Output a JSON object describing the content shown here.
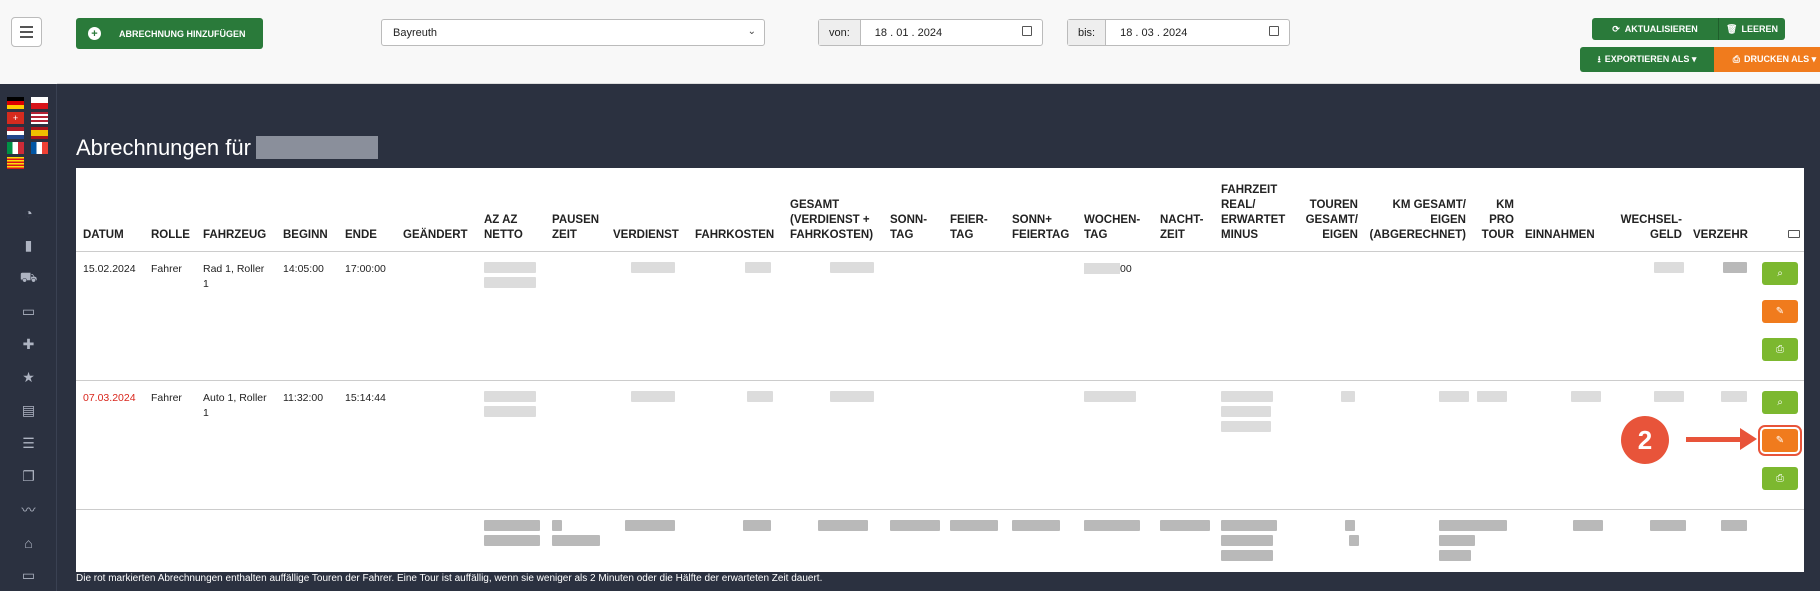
{
  "header": {
    "add_label": "ABRECHNUNG HINZUFÜGEN",
    "location": "Bayreuth",
    "from_label": "von:",
    "from_date": "18 . 01 . 2024",
    "to_label": "bis:",
    "to_date": "18 . 03 . 2024",
    "refresh_label": "AKTUALISIEREN",
    "clear_label": "LEEREN",
    "export_label": "EXPORTIEREN ALS ▾",
    "print_label": "DRUCKEN ALS ▾"
  },
  "page": {
    "title": "Abrechnungen für",
    "footnote": "Die rot markierten Abrechnungen enthalten auffällige Touren der Fahrer. Eine Tour ist auffällig, wenn sie weniger als 2 Minuten oder die Hälfte der erwarteten Zeit dauert."
  },
  "table": {
    "columns": [
      "DATUM",
      "ROLLE",
      "FAHRZEUG",
      "BEGINN",
      "ENDE",
      "GEÄNDERT",
      "AZ AZ NETTO",
      "PAUSEN ZEIT",
      "VERDIENST",
      "FAHRKOSTEN",
      "GESAMT (VERDIENST + FAHRKOSTEN)",
      "SONN-TAG",
      "FEIER-TAG",
      "SONN+ FEIERTAG",
      "WOCHEN-TAG",
      "NACHT-ZEIT",
      "FAHRZEIT REAL/ ERWARTET MINUS",
      "TOUREN GESAMT/ EIGEN",
      "KM GESAMT/ EIGEN (ABGERECHNET)",
      "KM PRO TOUR",
      "EINNAHMEN",
      "WECHSEL-GELD",
      "VERZEHR"
    ],
    "rows": [
      {
        "datum": "15.02.2024",
        "rolle": "Fahrer",
        "fahrzeug": "Rad 1, Roller 1",
        "beginn": "14:05:00",
        "ende": "17:00:00",
        "wochentag_tail": "00"
      },
      {
        "datum": "07.03.2024",
        "rolle": "Fahrer",
        "fahrzeug": "Auto 1, Roller 1",
        "beginn": "11:32:00",
        "ende": "15:14:44"
      }
    ]
  },
  "annotation": {
    "step": "2"
  },
  "colors": {
    "green": "#2a7a3a",
    "orange": "#f07b1d",
    "highlight": "#e8543a",
    "flagged": "#d9261c"
  }
}
